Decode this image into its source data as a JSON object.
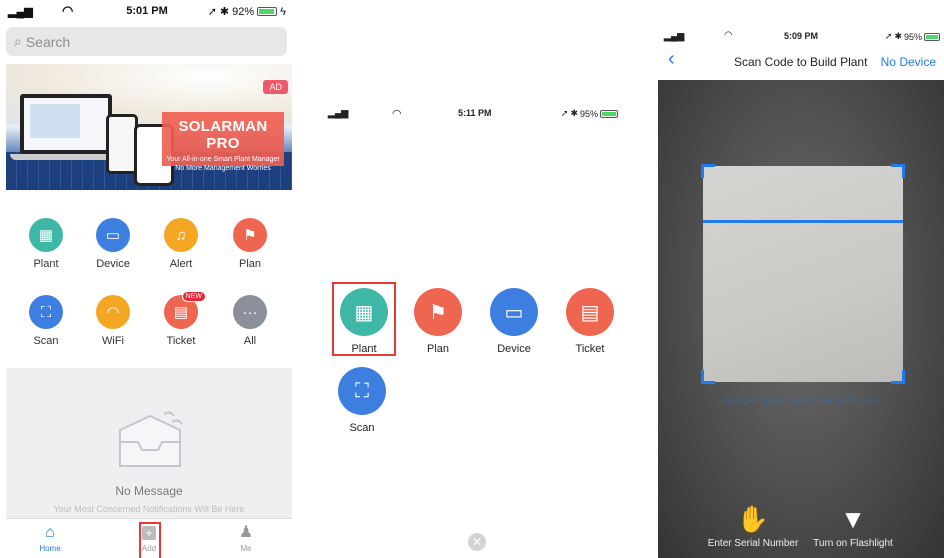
{
  "panel1": {
    "status": {
      "time": "5:01 PM",
      "battery": "92%"
    },
    "search": {
      "placeholder": "Search"
    },
    "banner": {
      "ad": "AD",
      "title": "SOLARMAN PRO",
      "line1": "Your All-in-one Smart Plant Manager",
      "line2": "No More Management Worries"
    },
    "grid": [
      {
        "label": "Plant",
        "color": "#3fb7a6",
        "icon": "solar-panel-icon"
      },
      {
        "label": "Device",
        "color": "#3d7fe0",
        "icon": "device-icon"
      },
      {
        "label": "Alert",
        "color": "#f5a623",
        "icon": "bell-icon"
      },
      {
        "label": "Plan",
        "color": "#ef6650",
        "icon": "flag-icon"
      },
      {
        "label": "Scan",
        "color": "#3d7fe0",
        "icon": "scan-icon"
      },
      {
        "label": "WiFi",
        "color": "#f5a623",
        "icon": "wifi-icon"
      },
      {
        "label": "Ticket",
        "color": "#ef6650",
        "icon": "ticket-icon",
        "badge": "NEW"
      },
      {
        "label": "All",
        "color": "#8a8f99",
        "icon": "more-icon"
      }
    ],
    "messages": {
      "empty": "No Message",
      "hint": "Your Most Concerned Notifications Will Be Here"
    },
    "tabs": {
      "home": "Home",
      "add": "Add",
      "me": "Me"
    }
  },
  "panel2": {
    "status": {
      "time": "5:11 PM",
      "battery": "95%"
    },
    "items": [
      {
        "label": "Plant",
        "color": "#3fb7a6",
        "icon": "solar-panel-icon"
      },
      {
        "label": "Plan",
        "color": "#ef6650",
        "icon": "flag-icon"
      },
      {
        "label": "Device",
        "color": "#3d7fe0",
        "icon": "device-icon"
      },
      {
        "label": "Ticket",
        "color": "#ef6650",
        "icon": "ticket-icon"
      },
      {
        "label": "Scan",
        "color": "#3d7fe0",
        "icon": "scan-icon"
      }
    ]
  },
  "panel3": {
    "status": {
      "time": "5:09 PM",
      "battery": "95%"
    },
    "title": "Scan Code to Build Plant",
    "no_device": "No Device",
    "hint": "Put QR Code / Bar Code in the box",
    "actions": {
      "serial": "Enter Serial Number",
      "flashlight": "Turn on Flashlight"
    }
  }
}
